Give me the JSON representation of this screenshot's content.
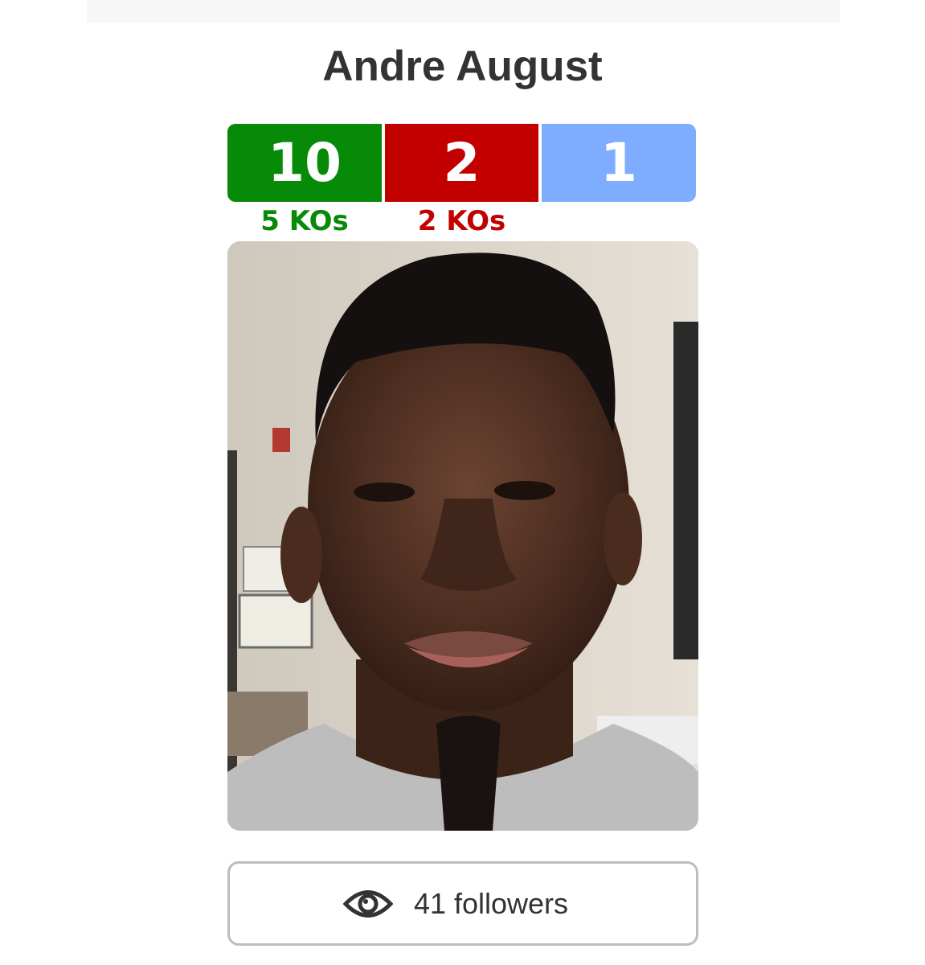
{
  "fighter": {
    "name": "Andre August",
    "record": {
      "wins": "10",
      "losses": "2",
      "draws": "1",
      "win_kos": "5 KOs",
      "loss_kos": "2 KOs"
    },
    "colors": {
      "win": "#078a07",
      "loss": "#c30000",
      "draw": "#7eadff"
    },
    "photo_alt": "Andre August"
  },
  "follow": {
    "icon": "eye-icon",
    "label": "41 followers"
  }
}
